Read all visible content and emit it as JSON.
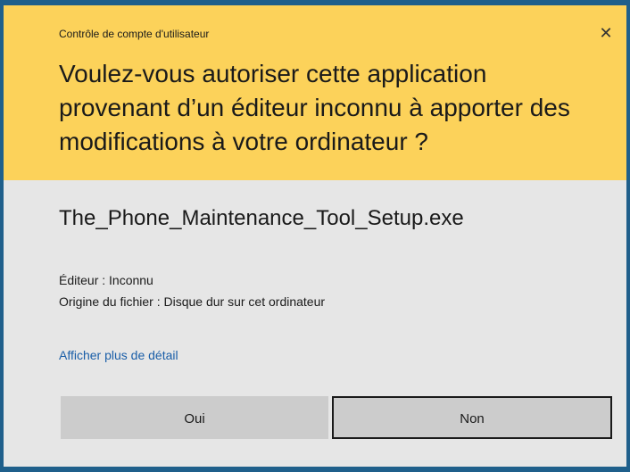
{
  "dialog": {
    "caption": "Contrôle de compte d'utilisateur",
    "close_glyph": "✕",
    "headline": "Voulez-vous autoriser cette application provenant d’un éditeur inconnu à apporter des modifications à votre ordinateur ?",
    "filename": "The_Phone_Maintenance_Tool_Setup.exe",
    "publisher": "Éditeur : Inconnu",
    "origin": "Origine du fichier : Disque dur sur cet ordinateur",
    "details_link": "Afficher plus de détail",
    "yes_label": "Oui",
    "no_label": "Non"
  },
  "colors": {
    "header_bg": "#fcd25a",
    "body_bg": "#e6e6e6",
    "frame": "#1f5f8b",
    "link": "#1a5ea8",
    "button_bg": "#cccccc"
  },
  "icons": {
    "close": "close-icon"
  }
}
